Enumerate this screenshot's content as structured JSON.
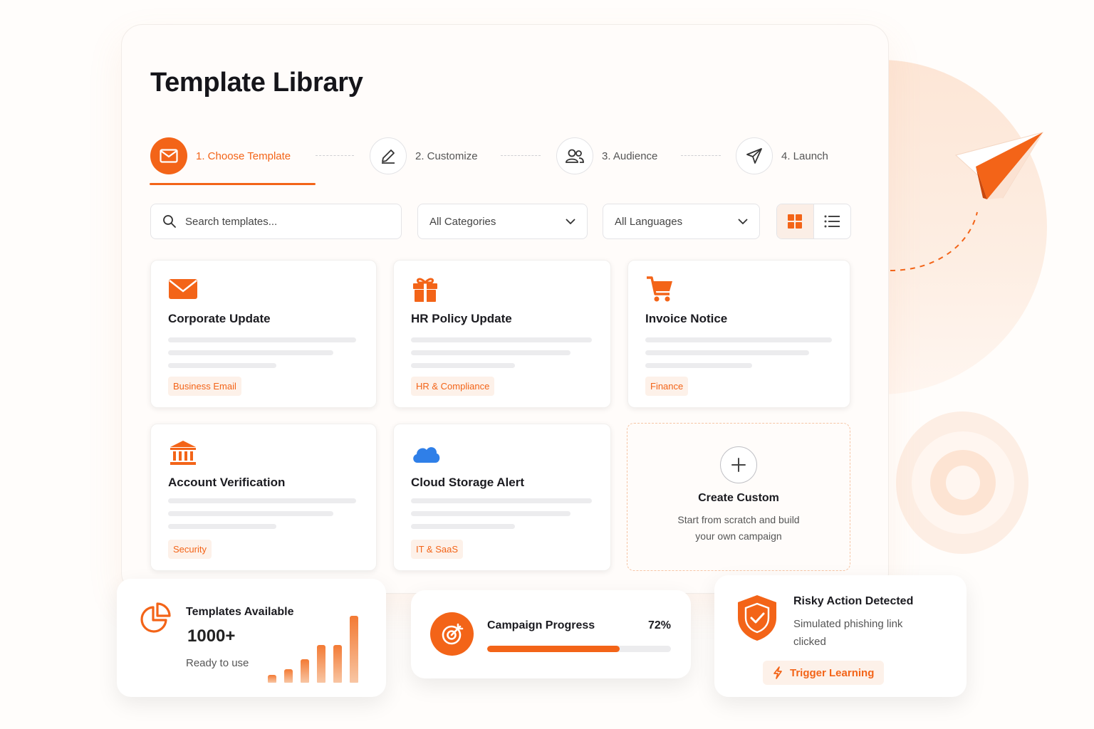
{
  "header": {
    "title": "Template Library"
  },
  "stepper": {
    "steps": [
      {
        "label": "1. Choose Template",
        "icon": "envelope-icon",
        "active": true
      },
      {
        "label": "2. Customize",
        "icon": "pen-icon",
        "active": false
      },
      {
        "label": "3. Audience",
        "icon": "users-icon",
        "active": false
      },
      {
        "label": "4. Launch",
        "icon": "paper-plane-icon",
        "active": false
      }
    ]
  },
  "toolbar": {
    "search_placeholder": "Search templates...",
    "category_select": "All Categories",
    "language_select": "All Languages",
    "view_mode": "grid"
  },
  "templates": [
    {
      "title": "Corporate Update",
      "tag": "Business Email",
      "icon": "envelope-icon"
    },
    {
      "title": "HR Policy Update",
      "tag": "HR & Compliance",
      "icon": "gift-icon"
    },
    {
      "title": "Invoice Notice",
      "tag": "Finance",
      "icon": "cart-icon"
    },
    {
      "title": "Account Verification",
      "tag": "Security",
      "icon": "bank-icon"
    },
    {
      "title": "Cloud Storage Alert",
      "tag": "IT & SaaS",
      "icon": "cloud-icon"
    }
  ],
  "custom": {
    "title": "Create Custom",
    "description": "Start from scratch and build your own campaign"
  },
  "stats": {
    "title": "Templates Available",
    "count": "1000+",
    "subtitle": "Ready to use"
  },
  "progress": {
    "title": "Campaign Progress",
    "percent_label": "72%",
    "value": 0.72
  },
  "alert": {
    "title": "Risky Action Detected",
    "subtitle": "Simulated phishing link clicked",
    "action_label": "Trigger Learning"
  },
  "colors": {
    "accent": "#f36418",
    "accent_soft": "#fdf1e9",
    "cloud": "#2f7fe8"
  }
}
